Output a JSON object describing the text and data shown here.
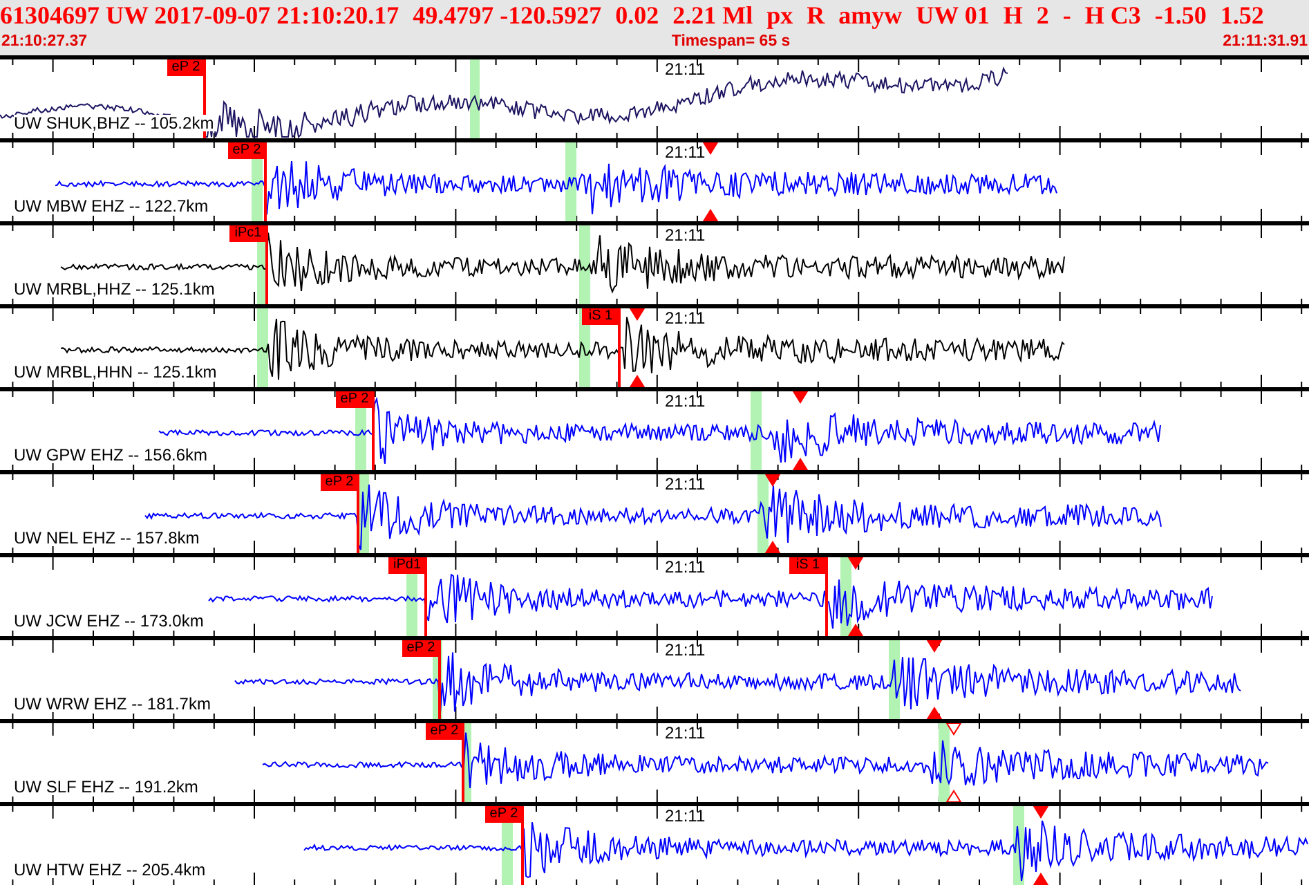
{
  "header": {
    "fields": [
      "61304697 UW 2017-09-07 21:10:20.17",
      "49.4797 -120.5927",
      "0.02",
      "2.21 Ml",
      "px",
      "R",
      "amyw",
      "UW 01",
      "H",
      "2",
      "-",
      "H C3",
      "-1.50",
      "1.52"
    ],
    "start_time": "21:10:27.37",
    "timespan": "Timespan=  65 s",
    "end_time": "21:11:31.91"
  },
  "traces": [
    {
      "label": "UW SHUK,BHZ -- 105.2km",
      "time_label": "21:11",
      "color": "#1c1460",
      "picks": [
        {
          "text": "eP 2"
        }
      ]
    },
    {
      "label": "UW MBW EHZ -- 122.7km",
      "time_label": "21:11",
      "color": "#0000ff",
      "picks": [
        {
          "text": "eP 2"
        }
      ],
      "markers": [
        {
          "filled": true
        }
      ]
    },
    {
      "label": "UW MRBL,HHZ -- 125.1km",
      "time_label": "21:11",
      "color": "#000000",
      "picks": [
        {
          "text": "iPc1"
        }
      ]
    },
    {
      "label": "UW MRBL,HHN -- 125.1km",
      "time_label": "21:11",
      "color": "#000000",
      "picks": [
        {
          "text": "iS 1"
        }
      ],
      "markers": [
        {
          "filled": true
        }
      ]
    },
    {
      "label": "UW GPW EHZ -- 156.6km",
      "time_label": "21:11",
      "color": "#0000ff",
      "picks": [
        {
          "text": "eP 2"
        }
      ],
      "markers": [
        {
          "filled": true
        }
      ]
    },
    {
      "label": "UW NEL EHZ -- 157.8km",
      "time_label": "21:11",
      "color": "#0000ff",
      "picks": [
        {
          "text": "eP 2"
        }
      ],
      "markers": [
        {
          "filled": true
        }
      ]
    },
    {
      "label": "UW JCW EHZ -- 173.0km",
      "time_label": "21:11",
      "color": "#0000ff",
      "picks": [
        {
          "text": "iPd1"
        },
        {
          "text": "iS 1"
        }
      ],
      "markers": [
        {
          "filled": true
        }
      ]
    },
    {
      "label": "UW WRW EHZ -- 181.7km",
      "time_label": "21:11",
      "color": "#0000ff",
      "picks": [
        {
          "text": "eP 2"
        }
      ],
      "markers": [
        {
          "filled": true
        }
      ]
    },
    {
      "label": "UW SLF EHZ -- 191.2km",
      "time_label": "21:11",
      "color": "#0000ff",
      "picks": [
        {
          "text": "eP 2"
        }
      ],
      "markers": [
        {
          "filled": false
        }
      ]
    },
    {
      "label": "UW HTW EHZ -- 205.4km",
      "time_label": "21:11",
      "color": "#0000ff",
      "picks": [
        {
          "text": "eP 2"
        }
      ],
      "markers": [
        {
          "filled": true
        }
      ]
    }
  ]
}
